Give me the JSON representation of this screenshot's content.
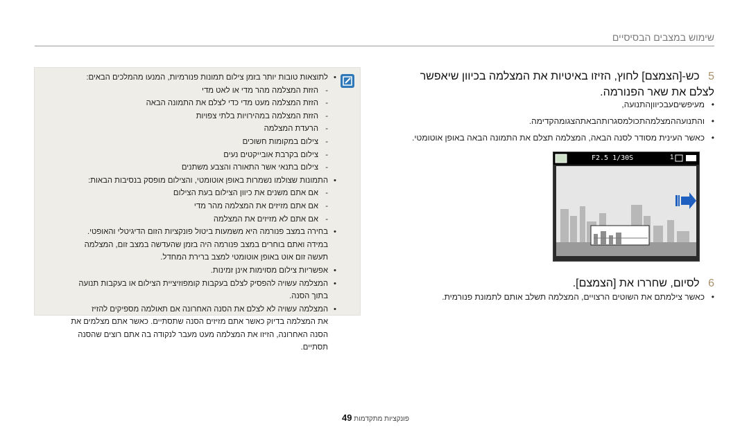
{
  "header": {
    "section_title": "שימוש במצבים הבסיסיים"
  },
  "step5": {
    "number": "5",
    "text": "כש-[הצמצם] לחוץ, הזיזו באיטיות את המצלמה בכיוון שיאפשר לצלם את שאר הפנורמה.",
    "bullets": [
      "מעיפשיםעבכיווןהתנועה,",
      "והתנועההמצלמהתכולמסגרותהבאתהצגומהקדימה.",
      "כאשר העינית מסודר לסנה הבאה, המצלמה תצלם את התמונה הבאה באופן אוטומטי."
    ]
  },
  "step6": {
    "number": "6",
    "text": "לסיום, שחררו את [הצמצם].",
    "bullets": [
      "כאשר צילמתם את השוטים הרצויים, המצלמה תשלב אותם לתמונת פנורמית."
    ]
  },
  "camera_screen": {
    "exposure": "F2.5 1/30S",
    "count": "1"
  },
  "note": {
    "icon": "note-icon",
    "items": [
      {
        "kind": "bullet",
        "text": "לתוצאות טובות יותר בזמן צילום תמונות פנורמיות, המנעו מהמלכים הבאים:"
      },
      {
        "kind": "sub",
        "text": "הזזת המצלמה מהר מדי או לאט מדי"
      },
      {
        "kind": "sub",
        "text": "הזזת המצלמה מעט מדי כדי לצלם את התמונה הבאה"
      },
      {
        "kind": "sub",
        "text": "הזזת המצלמה במהירויות בלתי צפויות"
      },
      {
        "kind": "sub",
        "text": "הרעדת המצלמה"
      },
      {
        "kind": "sub",
        "text": "צילום במקומות חשוכים"
      },
      {
        "kind": "sub",
        "text": "צילום בקרבת אובייקטים נעים"
      },
      {
        "kind": "sub",
        "text": "צילום בתנאי אשר התאורה והצבע משתנים"
      },
      {
        "kind": "bullet",
        "text": "התמונות שצולמו נשמרות באופן אוטומטי, והצילום מופסק בנסיבות הבאות:"
      },
      {
        "kind": "sub",
        "text": "אם אתם משנים את כיוון הצילום בעת הצילום"
      },
      {
        "kind": "sub",
        "text": "אם אתם מזיזים את המצלמה מהר מדי"
      },
      {
        "kind": "sub",
        "text": "אם אתם לא מזיזים את המצלמה"
      },
      {
        "kind": "bullet",
        "text": "בחירה במצב פנורמה היא משמעות ביטול פונקציות הזום הדיגיטלי והאופטי."
      },
      {
        "kind": "cont",
        "text": "במידה ואתם בוחרים במצב פנורמה היה בזמן שהעדשה במצב זום, המצלמה"
      },
      {
        "kind": "cont",
        "text": "תעשה זום אוט באופן אוטומטי למצב ברירת המחדל."
      },
      {
        "kind": "bullet",
        "text": "אפשריות צילום מסוימות אינן זמינות."
      },
      {
        "kind": "bullet",
        "text": "המצלמה עשויה להפסיק לצלם בעקבות קומפוזיציית הצילום או בעקבות תנועה"
      },
      {
        "kind": "cont",
        "text": "בתוך הסנה."
      },
      {
        "kind": "bullet",
        "text": "המצלמה עשויה לא לצלם את הסנה האחרונה אם תאולמה מספיקים להזיז"
      },
      {
        "kind": "cont",
        "text": "את המצלמה בדיוק כאשר אתם מזיזים הסנה שתסתיים. כאשר אתם מצלמים את"
      },
      {
        "kind": "cont",
        "text": "הסנה האחרונה, הזיזו את המצלמה מעט מעבר לנקודה בה אתם רוצים שהסנה"
      },
      {
        "kind": "cont",
        "text": "תסתיים."
      }
    ]
  },
  "footer": {
    "label": "פונקציות מתקדמות",
    "page": "49"
  }
}
